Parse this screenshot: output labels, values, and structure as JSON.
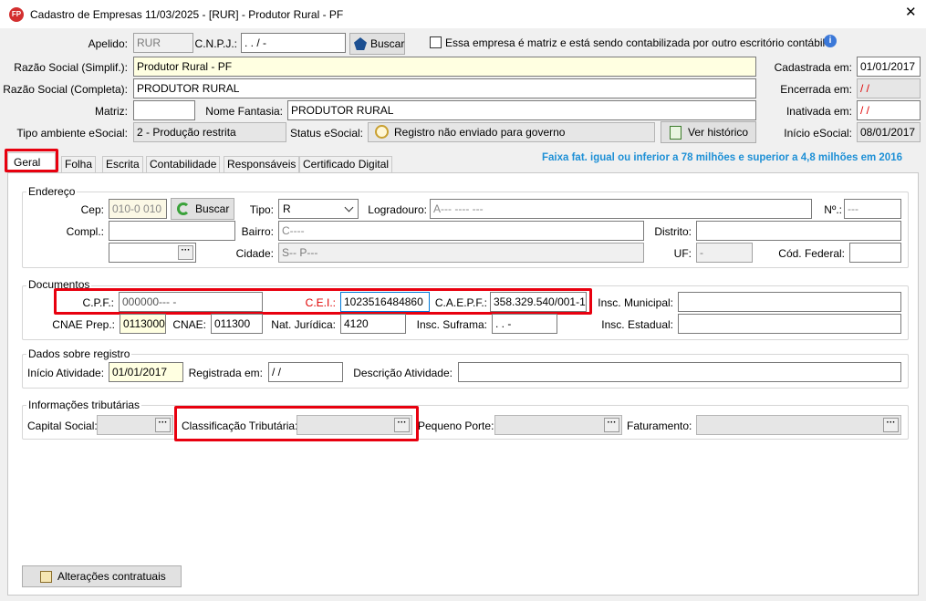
{
  "window": {
    "title": "Cadastro de Empresas  11/03/2025 - [RUR] - Produtor Rural - PF",
    "app_icon_text": "FP",
    "close_glyph": "✕"
  },
  "header": {
    "apelido_label": "Apelido:",
    "apelido_value": "RUR",
    "cnpj_label": "C.N.P.J.:",
    "cnpj_value": " .  .  /  -",
    "buscar_label": "Buscar",
    "matriz_checkbox_label": "Essa empresa é matriz e está sendo contabilizada por outro escritório contábil",
    "razao_simpl_label": "Razão Social (Simplif.):",
    "razao_simpl_value": "Produtor Rural - PF",
    "razao_comp_label": "Razão Social (Completa):",
    "razao_comp_value": "PRODUTOR RURAL",
    "matriz_label": "Matriz:",
    "matriz_value": "",
    "nome_fantasia_label": "Nome Fantasia:",
    "nome_fantasia_value": "PRODUTOR RURAL",
    "tipo_amb_label": "Tipo ambiente eSocial:",
    "tipo_amb_value": "2 - Produção restrita",
    "status_label": "Status eSocial:",
    "status_value": "Registro não enviado para governo",
    "historico_label": "Ver histórico",
    "cadastrada_label": "Cadastrada em:",
    "cadastrada_value": "01/01/2017",
    "encerrada_label": "Encerrada em:",
    "encerrada_value": " / /",
    "inativada_label": "Inativada em:",
    "inativada_value": " / /",
    "inicio_esocial_label": "Início eSocial:",
    "inicio_esocial_value": "08/01/2017"
  },
  "tabs": [
    {
      "label": "Geral"
    },
    {
      "label": "Folha"
    },
    {
      "label": "Escrita"
    },
    {
      "label": "Contabilidade"
    },
    {
      "label": "Responsáveis"
    },
    {
      "label": "Certificado Digital"
    }
  ],
  "faixa_text": "Faixa fat. igual ou inferior a 78 milhões e superior a 4,8 milhões em 2016",
  "endereco": {
    "title": "Endereço",
    "cep_label": "Cep:",
    "cep_value": "010-0 010",
    "buscar_label": "Buscar",
    "tipo_label": "Tipo:",
    "tipo_value": "R",
    "logradouro_label": "Logradouro:",
    "logradouro_value": "A---  ---- ---",
    "numero_label": "Nº.:",
    "numero_value": "---",
    "compl_label": "Compl.:",
    "compl_value": "",
    "bairro_label": "Bairro:",
    "bairro_value": "C----",
    "distrito_label": "Distrito:",
    "distrito_value": "",
    "cidade_label": "Cidade:",
    "cidade_value": "S-- P---",
    "uf_label": "UF:",
    "uf_value": "-",
    "cod_federal_label": "Cód. Federal:",
    "cod_federal_value": ""
  },
  "documentos": {
    "title": "Documentos",
    "cpf_label": "C.P.F.:",
    "cpf_value": "000000---  -",
    "cei_label": "C.E.I.:",
    "cei_value": "1023516484860",
    "caepf_label": "C.A.E.P.F.:",
    "caepf_value": "358.329.540/001-18",
    "insc_municipal_label": "Insc. Municipal:",
    "insc_municipal_value": "",
    "cnae_prep_label": "CNAE Prep.:",
    "cnae_prep_value": "0113000",
    "cnae_label": "CNAE:",
    "cnae_value": "011300",
    "nat_juridica_label": "Nat. Jurídica:",
    "nat_juridica_value": "4120",
    "insc_suframa_label": "Insc. Suframa:",
    "insc_suframa_value": "  .    .   -",
    "insc_estadual_label": "Insc. Estadual:",
    "insc_estadual_value": ""
  },
  "registro": {
    "title": "Dados sobre registro",
    "inicio_label": "Início Atividade:",
    "inicio_value": "01/01/2017",
    "registrada_label": "Registrada em:",
    "registrada_value": " / /",
    "descricao_label": "Descrição Atividade:",
    "descricao_value": ""
  },
  "tributarias": {
    "title": "Informações tributárias",
    "capital_label": "Capital Social:",
    "classificacao_label": "Classificação Tributária:",
    "pequeno_label": "Pequeno Porte:",
    "faturamento_label": "Faturamento:",
    "dots": "···"
  },
  "footer": {
    "alteracoes_label": "Alterações contratuais"
  },
  "colors": {
    "highlight_red": "#e8000f",
    "info_blue": "#1e90d6",
    "required_red": "#e00000"
  }
}
